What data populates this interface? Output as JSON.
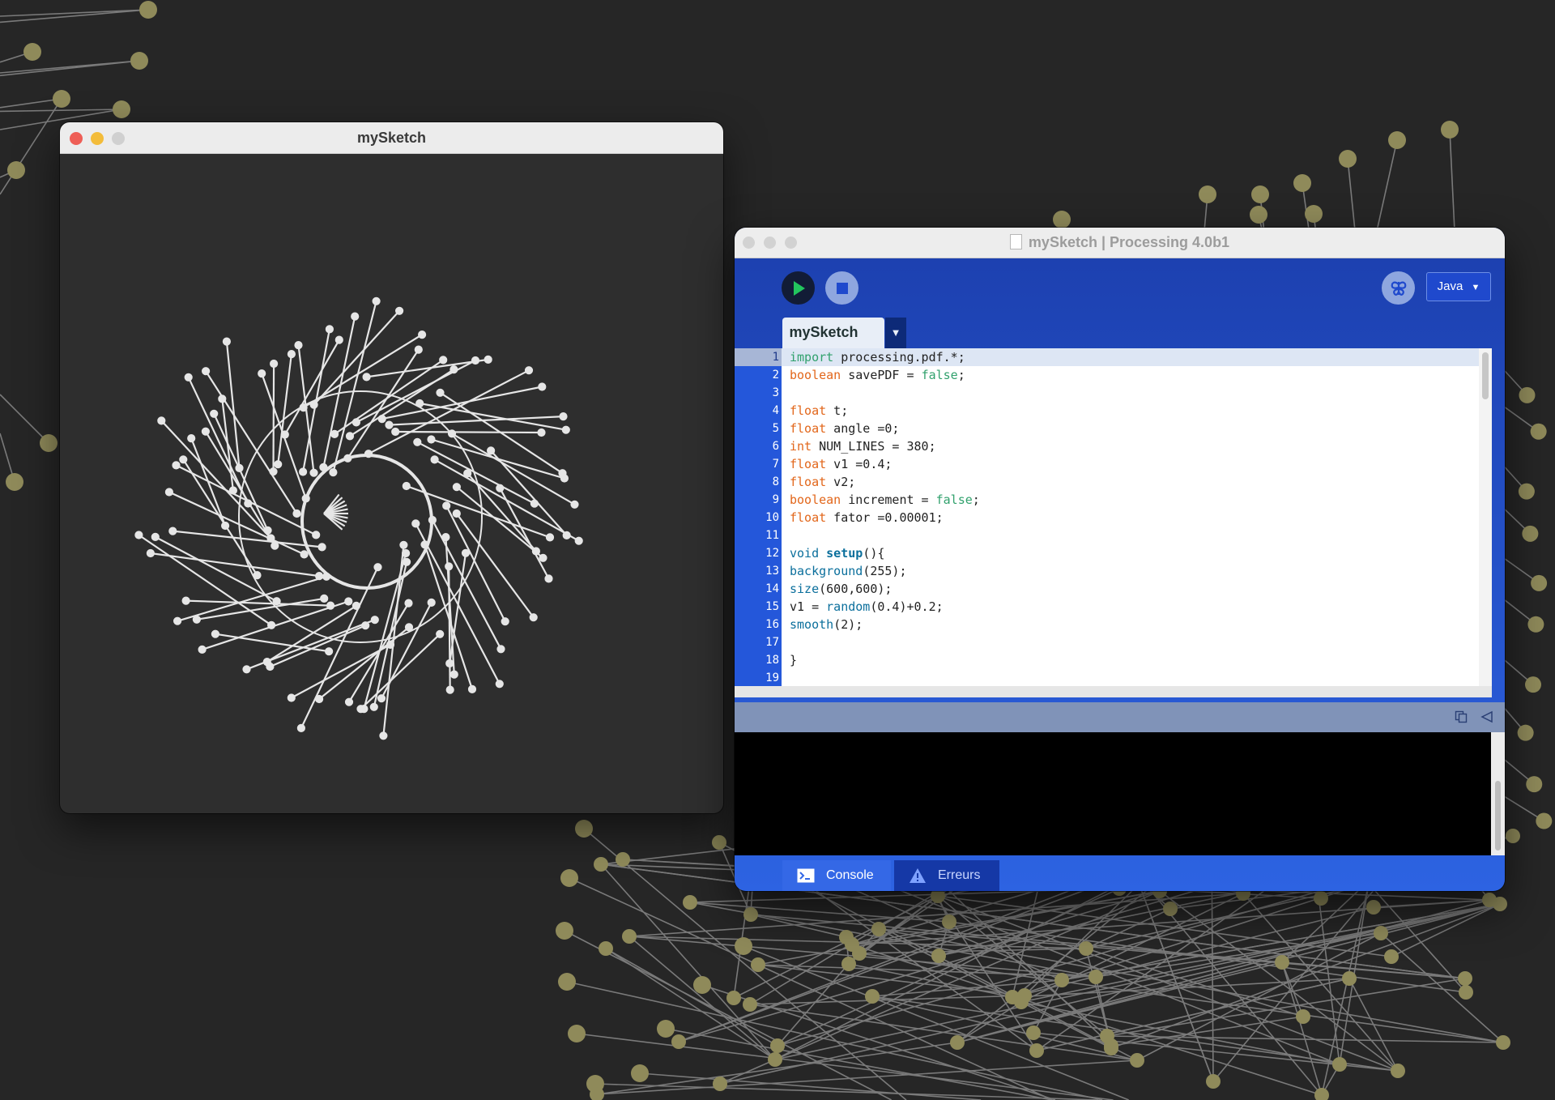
{
  "sketch_window": {
    "title": "mySketch"
  },
  "ide_window": {
    "title": "mySketch | Processing 4.0b1",
    "toolbar": {
      "run_icon": "play-icon",
      "stop_icon": "stop-icon",
      "debug_icon": "butterfly-debugger-icon",
      "mode_label": "Java",
      "mode_icon": "caret-down-icon"
    },
    "tabs": [
      {
        "label": "mySketch",
        "active": true
      }
    ],
    "tab_menu_icon": "caret-down-icon",
    "editor": {
      "current_line": 1,
      "lines": [
        {
          "n": "1",
          "code": "import processing.pdf.*;"
        },
        {
          "n": "2",
          "code": "boolean savePDF = false;"
        },
        {
          "n": "3",
          "code": ""
        },
        {
          "n": "4",
          "code": "float t;"
        },
        {
          "n": "5",
          "code": "float angle =0;"
        },
        {
          "n": "6",
          "code": "int NUM_LINES = 380;"
        },
        {
          "n": "7",
          "code": "float v1 =0.4;"
        },
        {
          "n": "8",
          "code": "float v2;"
        },
        {
          "n": "9",
          "code": "boolean increment = false;"
        },
        {
          "n": "10",
          "code": "float fator =0.00001;"
        },
        {
          "n": "11",
          "code": ""
        },
        {
          "n": "12",
          "code": "void setup(){"
        },
        {
          "n": "13",
          "code": "background(255);"
        },
        {
          "n": "14",
          "code": "size(600,600);"
        },
        {
          "n": "15",
          "code": "v1 = random(0.4)+0.2;"
        },
        {
          "n": "16",
          "code": "smooth(2);"
        },
        {
          "n": "17",
          "code": ""
        },
        {
          "n": "18",
          "code": "}"
        },
        {
          "n": "19",
          "code": ""
        }
      ]
    },
    "status_bar": {
      "copy_icon": "copy-icon",
      "collapse_icon": "collapse-triangle-icon"
    },
    "console_output": "",
    "bottom_tabs": [
      {
        "label": "Console",
        "icon": "terminal-icon",
        "active": true
      },
      {
        "label": "Erreurs",
        "icon": "warning-icon",
        "active": false
      }
    ]
  },
  "colors": {
    "desktop_bg": "#262626",
    "ide_blue": "#2457da",
    "keyword_orange": "#e2661a",
    "literal_green": "#31a16d",
    "function_teal": "#0b6f9c",
    "node_olive": "#8f8a5a"
  }
}
